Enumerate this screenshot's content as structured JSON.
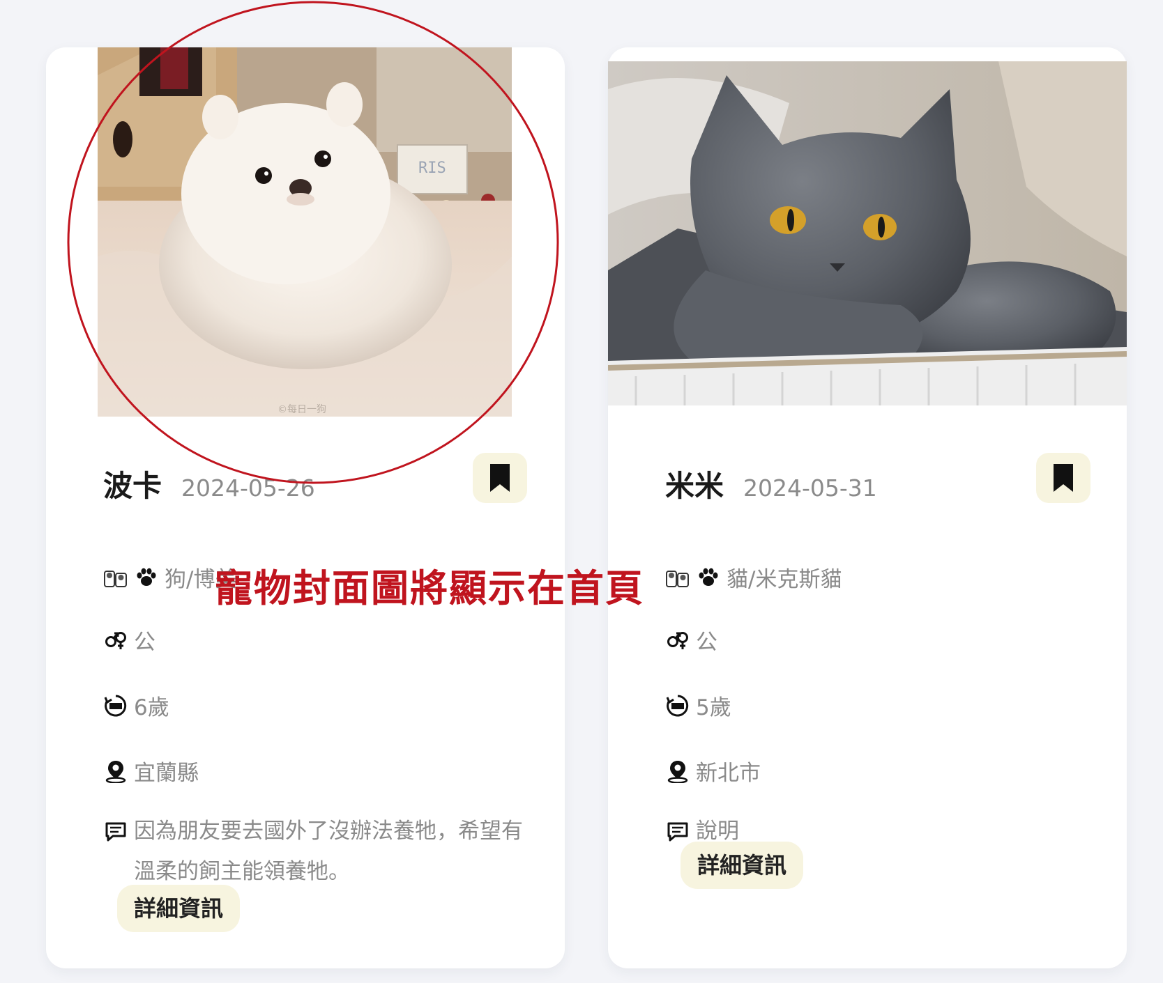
{
  "cards": [
    {
      "name": "波卡",
      "date": "2024-05-26",
      "species": "狗/博美",
      "gender": "公",
      "age": "6歲",
      "location": "宜蘭縣",
      "description": "因為朋友要去國外了沒辦法養牠，希望有溫柔的飼主能領養牠。",
      "detail_label": "詳細資訊",
      "photo_watermark": "©每日一狗",
      "photo_sign_text": "RIS"
    },
    {
      "name": "米米",
      "date": "2024-05-31",
      "species": "貓/米克斯貓",
      "gender": "公",
      "age": "5歲",
      "location": "新北市",
      "description": "說明",
      "detail_label": "詳細資訊"
    }
  ],
  "annotation": {
    "text": "寵物封面圖將顯示在首頁",
    "color": "#c0141e"
  },
  "colors": {
    "page_bg": "#f3f4f8",
    "card_bg": "#ffffff",
    "button_bg": "#f7f4df",
    "muted_text": "#8a8a8a"
  }
}
